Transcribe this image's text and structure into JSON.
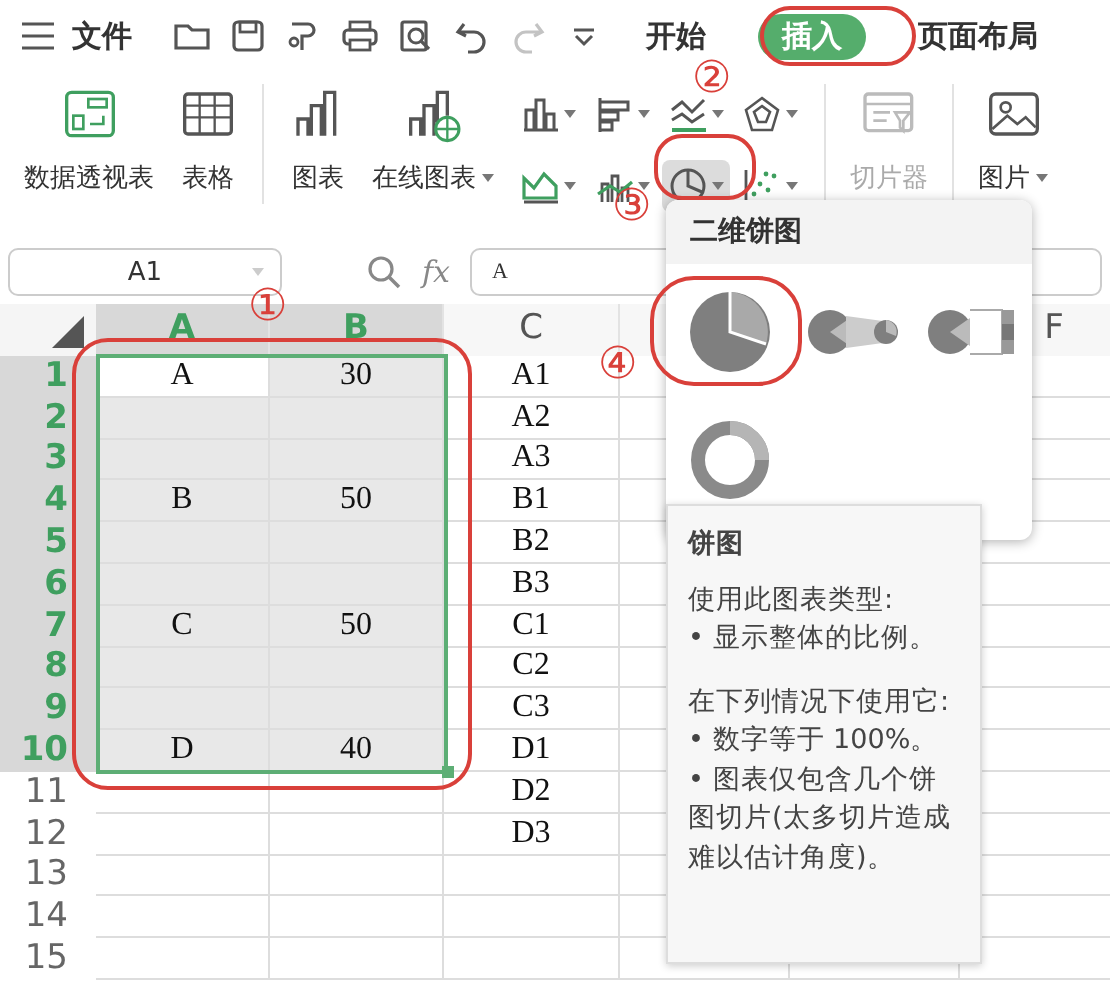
{
  "top_bar": {
    "file_label": "文件",
    "quick_access": [
      {
        "kind": "open",
        "disabled": false
      },
      {
        "kind": "save",
        "disabled": false
      },
      {
        "kind": "painter",
        "disabled": false
      },
      {
        "kind": "print",
        "disabled": false
      },
      {
        "kind": "preview",
        "disabled": false
      },
      {
        "kind": "undo",
        "disabled": false
      },
      {
        "kind": "redo",
        "disabled": true
      },
      {
        "kind": "more",
        "disabled": false
      }
    ],
    "tabs": [
      {
        "label": "开始",
        "selected": false
      },
      {
        "label": "插入",
        "selected": true
      },
      {
        "label": "页面布局",
        "selected": false
      }
    ]
  },
  "ribbon": {
    "left_items": [
      {
        "label": "数据透视表",
        "kind": "pivot",
        "dropdown": false,
        "disabled": false
      },
      {
        "label": "表格",
        "kind": "table",
        "dropdown": false,
        "disabled": false
      },
      {
        "label": "图表",
        "kind": "chart",
        "dropdown": false,
        "disabled": false
      },
      {
        "label": "在线图表",
        "kind": "online",
        "dropdown": true,
        "disabled": false
      }
    ],
    "chart_buttons": [
      {
        "kind": "column",
        "selected": false
      },
      {
        "kind": "bar",
        "selected": false
      },
      {
        "kind": "line",
        "selected": false
      },
      {
        "kind": "radar",
        "selected": false
      },
      {
        "kind": "area",
        "selected": false
      },
      {
        "kind": "combo",
        "selected": false
      },
      {
        "kind": "pie",
        "selected": true
      },
      {
        "kind": "scatter",
        "selected": false
      }
    ],
    "right_items": [
      {
        "label": "切片器",
        "kind": "slicer",
        "dropdown": false,
        "disabled": true
      },
      {
        "label": "图片",
        "kind": "picture",
        "dropdown": true,
        "disabled": false
      }
    ]
  },
  "formula_bar": {
    "name_box": "A1",
    "fx": "fx",
    "value": "A"
  },
  "sheet": {
    "columns": [
      {
        "label": "A",
        "selected": true
      },
      {
        "label": "B",
        "selected": true
      },
      {
        "label": "C",
        "selected": false
      },
      {
        "label": "F",
        "selected": false
      }
    ],
    "rows": [
      {
        "number": "1",
        "selected": true,
        "cells": [
          {
            "text": "A",
            "selected": true,
            "active": true
          },
          {
            "text": "30",
            "selected": true,
            "active": false
          },
          {
            "text": "A1",
            "selected": false,
            "active": false
          }
        ]
      },
      {
        "number": "2",
        "selected": true,
        "cells": [
          {
            "selected": true,
            "active": false
          },
          {
            "selected": true,
            "active": false
          },
          {
            "text": "A2",
            "selected": false,
            "active": false
          }
        ]
      },
      {
        "number": "3",
        "selected": true,
        "cells": [
          {
            "selected": true,
            "active": false
          },
          {
            "selected": true,
            "active": false
          },
          {
            "text": "A3",
            "selected": false,
            "active": false
          }
        ]
      },
      {
        "number": "4",
        "selected": true,
        "cells": [
          {
            "text": "B",
            "selected": true,
            "active": false
          },
          {
            "text": "50",
            "selected": true,
            "active": false
          },
          {
            "text": "B1",
            "selected": false,
            "active": false
          }
        ]
      },
      {
        "number": "5",
        "selected": true,
        "cells": [
          {
            "selected": true,
            "active": false
          },
          {
            "selected": true,
            "active": false
          },
          {
            "text": "B2",
            "selected": false,
            "active": false
          }
        ]
      },
      {
        "number": "6",
        "selected": true,
        "cells": [
          {
            "selected": true,
            "active": false
          },
          {
            "selected": true,
            "active": false
          },
          {
            "text": "B3",
            "selected": false,
            "active": false
          }
        ]
      },
      {
        "number": "7",
        "selected": true,
        "cells": [
          {
            "text": "C",
            "selected": true,
            "active": false
          },
          {
            "text": "50",
            "selected": true,
            "active": false
          },
          {
            "text": "C1",
            "selected": false,
            "active": false
          }
        ]
      },
      {
        "number": "8",
        "selected": true,
        "cells": [
          {
            "selected": true,
            "active": false
          },
          {
            "selected": true,
            "active": false
          },
          {
            "text": "C2",
            "selected": false,
            "active": false
          }
        ]
      },
      {
        "number": "9",
        "selected": true,
        "cells": [
          {
            "selected": true,
            "active": false
          },
          {
            "selected": true,
            "active": false
          },
          {
            "text": "C3",
            "selected": false,
            "active": false
          }
        ]
      },
      {
        "number": "10",
        "selected": true,
        "cells": [
          {
            "text": "D",
            "selected": true,
            "active": false
          },
          {
            "text": "40",
            "selected": true,
            "active": false
          },
          {
            "text": "D1",
            "selected": false,
            "active": false
          }
        ]
      },
      {
        "number": "11",
        "selected": false,
        "cells": [
          {
            "selected": false,
            "active": false
          },
          {
            "selected": false,
            "active": false
          },
          {
            "text": "D2",
            "selected": false,
            "active": false
          }
        ]
      },
      {
        "number": "12",
        "selected": false,
        "cells": [
          {
            "selected": false,
            "active": false
          },
          {
            "selected": false,
            "active": false
          },
          {
            "text": "D3",
            "selected": false,
            "active": false
          }
        ]
      },
      {
        "number": "13",
        "selected": false,
        "cells": []
      },
      {
        "number": "14",
        "selected": false,
        "cells": []
      },
      {
        "number": "15",
        "selected": false,
        "cells": []
      }
    ]
  },
  "pie_menu": {
    "title": "二维饼图",
    "options": [
      {
        "kind": "pie"
      },
      {
        "kind": "pie-of-pie"
      },
      {
        "kind": "bar-of-pie"
      },
      {
        "kind": "doughnut"
      }
    ]
  },
  "tooltip": {
    "title": "饼图",
    "sections": [
      {
        "heading": "使用此图表类型:",
        "bullets": [
          "• 显示整体的比例。"
        ]
      },
      {
        "heading": "在下列情况下使用它:",
        "bullets": [
          "• 数字等于 100%。",
          "• 图表仅包含几个饼图切片(太多切片造成难以估计角度)。"
        ]
      }
    ]
  },
  "annotations": [
    {
      "label": "①"
    },
    {
      "label": "②"
    },
    {
      "label": "③"
    },
    {
      "label": "④"
    }
  ]
}
